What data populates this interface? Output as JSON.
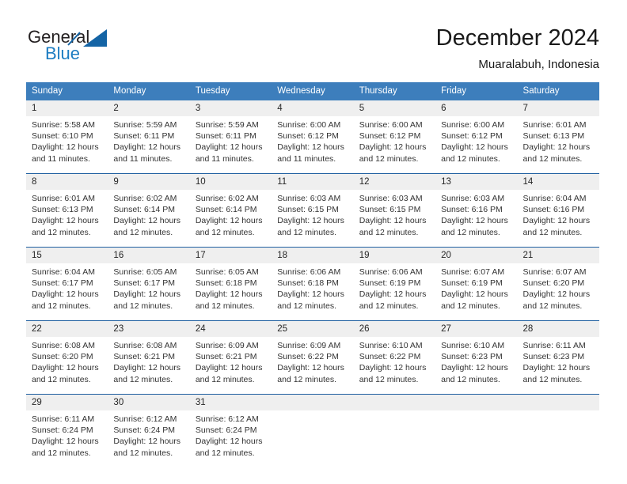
{
  "brand": {
    "name_part1": "General",
    "name_part2": "Blue",
    "accent_color": "#1464a5",
    "blue_text_color": "#1d7dc2"
  },
  "header": {
    "title": "December 2024",
    "subtitle": "Muaralabuh, Indonesia"
  },
  "calendar": {
    "header_bg": "#3d7ebc",
    "daynum_bg": "#efefef",
    "rule_color": "#1f5fa0",
    "weekdays": [
      "Sunday",
      "Monday",
      "Tuesday",
      "Wednesday",
      "Thursday",
      "Friday",
      "Saturday"
    ],
    "weeks": [
      {
        "days": [
          {
            "date": "1",
            "sunrise": "Sunrise: 5:58 AM",
            "sunset": "Sunset: 6:10 PM",
            "daylight1": "Daylight: 12 hours",
            "daylight2": "and 11 minutes."
          },
          {
            "date": "2",
            "sunrise": "Sunrise: 5:59 AM",
            "sunset": "Sunset: 6:11 PM",
            "daylight1": "Daylight: 12 hours",
            "daylight2": "and 11 minutes."
          },
          {
            "date": "3",
            "sunrise": "Sunrise: 5:59 AM",
            "sunset": "Sunset: 6:11 PM",
            "daylight1": "Daylight: 12 hours",
            "daylight2": "and 11 minutes."
          },
          {
            "date": "4",
            "sunrise": "Sunrise: 6:00 AM",
            "sunset": "Sunset: 6:12 PM",
            "daylight1": "Daylight: 12 hours",
            "daylight2": "and 11 minutes."
          },
          {
            "date": "5",
            "sunrise": "Sunrise: 6:00 AM",
            "sunset": "Sunset: 6:12 PM",
            "daylight1": "Daylight: 12 hours",
            "daylight2": "and 12 minutes."
          },
          {
            "date": "6",
            "sunrise": "Sunrise: 6:00 AM",
            "sunset": "Sunset: 6:12 PM",
            "daylight1": "Daylight: 12 hours",
            "daylight2": "and 12 minutes."
          },
          {
            "date": "7",
            "sunrise": "Sunrise: 6:01 AM",
            "sunset": "Sunset: 6:13 PM",
            "daylight1": "Daylight: 12 hours",
            "daylight2": "and 12 minutes."
          }
        ]
      },
      {
        "days": [
          {
            "date": "8",
            "sunrise": "Sunrise: 6:01 AM",
            "sunset": "Sunset: 6:13 PM",
            "daylight1": "Daylight: 12 hours",
            "daylight2": "and 12 minutes."
          },
          {
            "date": "9",
            "sunrise": "Sunrise: 6:02 AM",
            "sunset": "Sunset: 6:14 PM",
            "daylight1": "Daylight: 12 hours",
            "daylight2": "and 12 minutes."
          },
          {
            "date": "10",
            "sunrise": "Sunrise: 6:02 AM",
            "sunset": "Sunset: 6:14 PM",
            "daylight1": "Daylight: 12 hours",
            "daylight2": "and 12 minutes."
          },
          {
            "date": "11",
            "sunrise": "Sunrise: 6:03 AM",
            "sunset": "Sunset: 6:15 PM",
            "daylight1": "Daylight: 12 hours",
            "daylight2": "and 12 minutes."
          },
          {
            "date": "12",
            "sunrise": "Sunrise: 6:03 AM",
            "sunset": "Sunset: 6:15 PM",
            "daylight1": "Daylight: 12 hours",
            "daylight2": "and 12 minutes."
          },
          {
            "date": "13",
            "sunrise": "Sunrise: 6:03 AM",
            "sunset": "Sunset: 6:16 PM",
            "daylight1": "Daylight: 12 hours",
            "daylight2": "and 12 minutes."
          },
          {
            "date": "14",
            "sunrise": "Sunrise: 6:04 AM",
            "sunset": "Sunset: 6:16 PM",
            "daylight1": "Daylight: 12 hours",
            "daylight2": "and 12 minutes."
          }
        ]
      },
      {
        "days": [
          {
            "date": "15",
            "sunrise": "Sunrise: 6:04 AM",
            "sunset": "Sunset: 6:17 PM",
            "daylight1": "Daylight: 12 hours",
            "daylight2": "and 12 minutes."
          },
          {
            "date": "16",
            "sunrise": "Sunrise: 6:05 AM",
            "sunset": "Sunset: 6:17 PM",
            "daylight1": "Daylight: 12 hours",
            "daylight2": "and 12 minutes."
          },
          {
            "date": "17",
            "sunrise": "Sunrise: 6:05 AM",
            "sunset": "Sunset: 6:18 PM",
            "daylight1": "Daylight: 12 hours",
            "daylight2": "and 12 minutes."
          },
          {
            "date": "18",
            "sunrise": "Sunrise: 6:06 AM",
            "sunset": "Sunset: 6:18 PM",
            "daylight1": "Daylight: 12 hours",
            "daylight2": "and 12 minutes."
          },
          {
            "date": "19",
            "sunrise": "Sunrise: 6:06 AM",
            "sunset": "Sunset: 6:19 PM",
            "daylight1": "Daylight: 12 hours",
            "daylight2": "and 12 minutes."
          },
          {
            "date": "20",
            "sunrise": "Sunrise: 6:07 AM",
            "sunset": "Sunset: 6:19 PM",
            "daylight1": "Daylight: 12 hours",
            "daylight2": "and 12 minutes."
          },
          {
            "date": "21",
            "sunrise": "Sunrise: 6:07 AM",
            "sunset": "Sunset: 6:20 PM",
            "daylight1": "Daylight: 12 hours",
            "daylight2": "and 12 minutes."
          }
        ]
      },
      {
        "days": [
          {
            "date": "22",
            "sunrise": "Sunrise: 6:08 AM",
            "sunset": "Sunset: 6:20 PM",
            "daylight1": "Daylight: 12 hours",
            "daylight2": "and 12 minutes."
          },
          {
            "date": "23",
            "sunrise": "Sunrise: 6:08 AM",
            "sunset": "Sunset: 6:21 PM",
            "daylight1": "Daylight: 12 hours",
            "daylight2": "and 12 minutes."
          },
          {
            "date": "24",
            "sunrise": "Sunrise: 6:09 AM",
            "sunset": "Sunset: 6:21 PM",
            "daylight1": "Daylight: 12 hours",
            "daylight2": "and 12 minutes."
          },
          {
            "date": "25",
            "sunrise": "Sunrise: 6:09 AM",
            "sunset": "Sunset: 6:22 PM",
            "daylight1": "Daylight: 12 hours",
            "daylight2": "and 12 minutes."
          },
          {
            "date": "26",
            "sunrise": "Sunrise: 6:10 AM",
            "sunset": "Sunset: 6:22 PM",
            "daylight1": "Daylight: 12 hours",
            "daylight2": "and 12 minutes."
          },
          {
            "date": "27",
            "sunrise": "Sunrise: 6:10 AM",
            "sunset": "Sunset: 6:23 PM",
            "daylight1": "Daylight: 12 hours",
            "daylight2": "and 12 minutes."
          },
          {
            "date": "28",
            "sunrise": "Sunrise: 6:11 AM",
            "sunset": "Sunset: 6:23 PM",
            "daylight1": "Daylight: 12 hours",
            "daylight2": "and 12 minutes."
          }
        ]
      },
      {
        "days": [
          {
            "date": "29",
            "sunrise": "Sunrise: 6:11 AM",
            "sunset": "Sunset: 6:24 PM",
            "daylight1": "Daylight: 12 hours",
            "daylight2": "and 12 minutes."
          },
          {
            "date": "30",
            "sunrise": "Sunrise: 6:12 AM",
            "sunset": "Sunset: 6:24 PM",
            "daylight1": "Daylight: 12 hours",
            "daylight2": "and 12 minutes."
          },
          {
            "date": "31",
            "sunrise": "Sunrise: 6:12 AM",
            "sunset": "Sunset: 6:24 PM",
            "daylight1": "Daylight: 12 hours",
            "daylight2": "and 12 minutes."
          },
          {
            "date": "",
            "sunrise": "",
            "sunset": "",
            "daylight1": "",
            "daylight2": ""
          },
          {
            "date": "",
            "sunrise": "",
            "sunset": "",
            "daylight1": "",
            "daylight2": ""
          },
          {
            "date": "",
            "sunrise": "",
            "sunset": "",
            "daylight1": "",
            "daylight2": ""
          },
          {
            "date": "",
            "sunrise": "",
            "sunset": "",
            "daylight1": "",
            "daylight2": ""
          }
        ]
      }
    ]
  }
}
